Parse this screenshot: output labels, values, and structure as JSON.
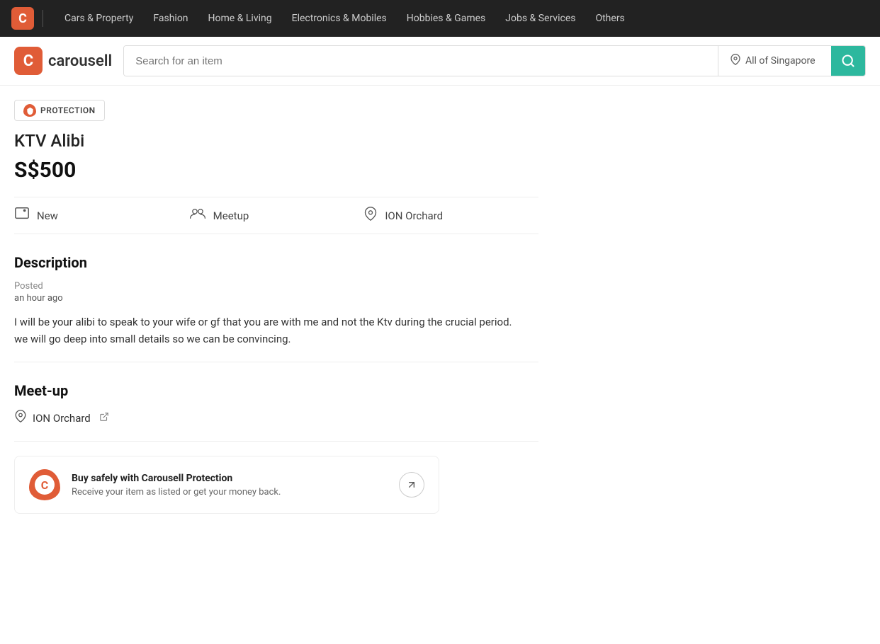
{
  "topnav": {
    "logo_label": "C",
    "items": [
      {
        "label": "Cars & Property",
        "id": "cars-property"
      },
      {
        "label": "Fashion",
        "id": "fashion"
      },
      {
        "label": "Home & Living",
        "id": "home-living"
      },
      {
        "label": "Electronics & Mobiles",
        "id": "electronics"
      },
      {
        "label": "Hobbies & Games",
        "id": "hobbies"
      },
      {
        "label": "Jobs & Services",
        "id": "jobs"
      },
      {
        "label": "Others",
        "id": "others"
      }
    ]
  },
  "header": {
    "brand_text": "carousell",
    "search_placeholder": "Search for an item",
    "location_text": "All of Singapore",
    "search_button_label": "🔍"
  },
  "listing": {
    "protection_badge": "PROTECTION",
    "title": "KTV Alibi",
    "price": "S$500",
    "condition": "New",
    "meetup_type": "Meetup",
    "location": "ION Orchard"
  },
  "description": {
    "section_title": "Description",
    "posted_label": "Posted",
    "posted_time": "an hour ago",
    "body": "I will be your alibi to speak to your wife or gf that you are with me and not the Ktv during the crucial period.\nwe will go deep into small details so we can be convincing."
  },
  "meetup": {
    "section_title": "Meet-up",
    "location": "ION Orchard"
  },
  "protection": {
    "logo_label": "C",
    "title": "Buy safely with Carousell Protection",
    "subtitle": "Receive your item as listed or get your money back."
  }
}
